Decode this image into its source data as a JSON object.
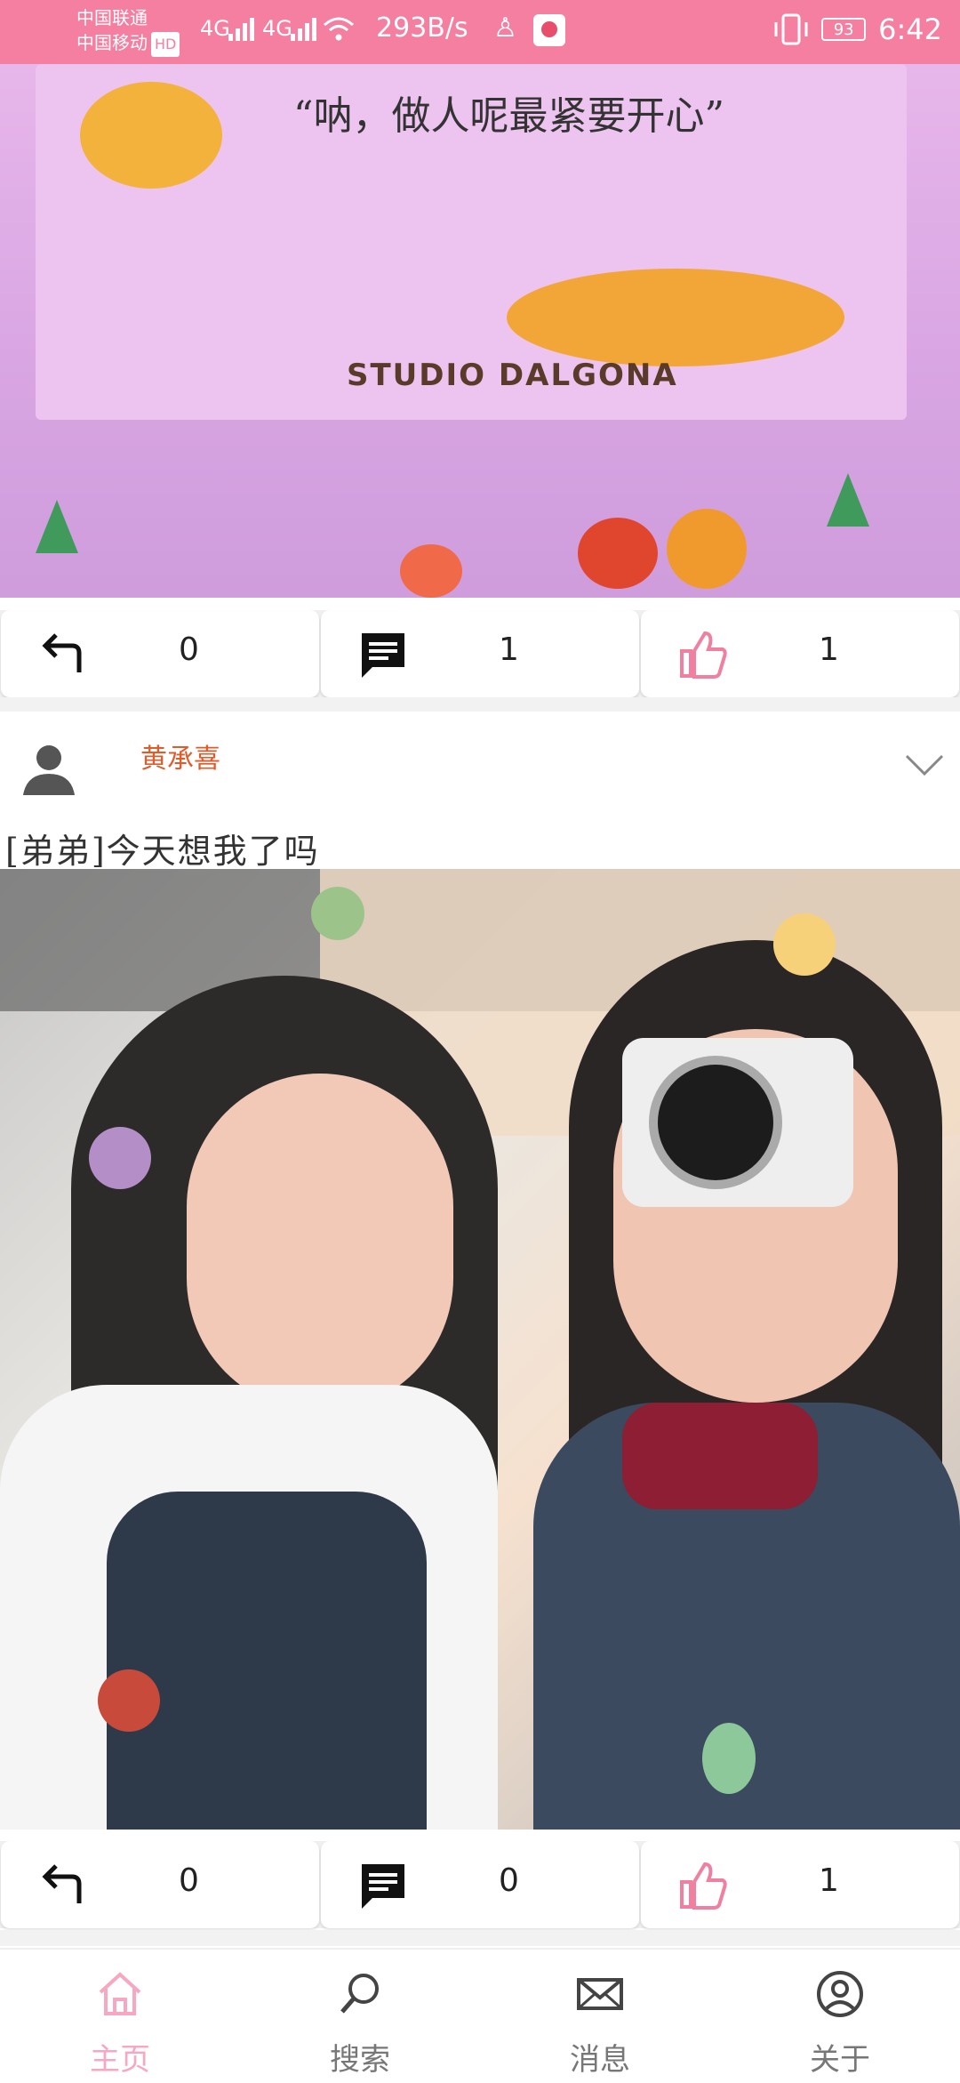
{
  "status_bar": {
    "carrier_1": "中国联通",
    "carrier_2": "中国移动",
    "hd": "HD",
    "signal_1": "4G",
    "signal_2": "4G",
    "speed": "293B/s",
    "battery": "93",
    "time": "6:42"
  },
  "posts": [
    {
      "image_quote": "“呐，做人呢最紧要开心”",
      "image_label": "STUDIO DALGONA",
      "actions": {
        "repost": "0",
        "comment": "1",
        "like": "1"
      }
    },
    {
      "author": "黄承喜",
      "text": "[弟弟]今天想我了吗",
      "actions": {
        "repost": "0",
        "comment": "0",
        "like": "1"
      }
    }
  ],
  "nav": {
    "items": [
      {
        "label": "主页",
        "icon": "home-icon",
        "active": true
      },
      {
        "label": "搜索",
        "icon": "search-icon",
        "active": false
      },
      {
        "label": "消息",
        "icon": "mail-icon",
        "active": false
      },
      {
        "label": "关于",
        "icon": "user-circle-icon",
        "active": false
      }
    ]
  },
  "colors": {
    "accent": "#f47fa0",
    "author": "#e05a2a",
    "like": "#f07fa0"
  }
}
